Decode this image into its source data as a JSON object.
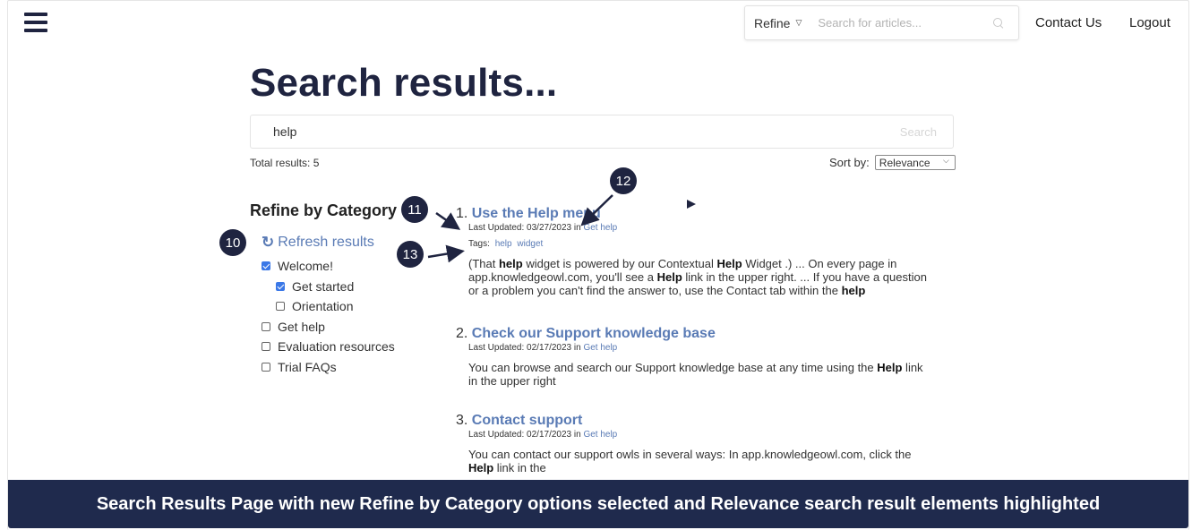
{
  "header": {
    "refine_label": "Refine",
    "search_placeholder": "Search for articles...",
    "contact_label": "Contact Us",
    "logout_label": "Logout"
  },
  "main": {
    "title": "Search results...",
    "search_value": "help",
    "search_button": "Search",
    "total_results": "Total results: 5",
    "sort_label": "Sort by:",
    "sort_value": "Relevance"
  },
  "sidebar": {
    "title": "Refine by Category",
    "refresh_label": "Refresh results",
    "categories": [
      {
        "label": "Welcome!",
        "checked": true
      },
      {
        "label": "Get started",
        "checked": true
      },
      {
        "label": "Orientation",
        "checked": false
      },
      {
        "label": "Get help",
        "checked": false
      },
      {
        "label": "Evaluation resources",
        "checked": false
      },
      {
        "label": "Trial FAQs",
        "checked": false
      }
    ]
  },
  "results": [
    {
      "num": "1.",
      "title": "Use the Help menu",
      "updated": "Last Updated: 03/27/2023 in",
      "category": "Get help",
      "tags_label": "Tags:",
      "tags": [
        "help",
        "widget"
      ],
      "snippet_parts": [
        "(That ",
        "help",
        " widget is powered by our Contextual ",
        "Help",
        " Widget .) ... On every page in app.knowledgeowl.com, you'll see a ",
        "Help",
        " link in the upper right. ... If you have a question or a problem you can't find the answer to, use the Contact tab within the ",
        "help",
        ""
      ]
    },
    {
      "num": "2.",
      "title": "Check our Support knowledge base",
      "updated": "Last Updated: 02/17/2023 in",
      "category": "Get help",
      "snippet_parts": [
        "You can browse and search our Support knowledge base at any time using the ",
        "Help",
        "  link in the upper right"
      ]
    },
    {
      "num": "3.",
      "title": "Contact support",
      "updated": "Last Updated: 02/17/2023 in",
      "category": "Get help",
      "snippet_parts": [
        "You can contact our support owls in several ways: In app.knowledgeowl.com, click the ",
        "Help",
        " link in the"
      ]
    }
  ],
  "callouts": [
    "10",
    "11",
    "12",
    "13"
  ],
  "caption": "Search Results Page with new Refine by Category options selected and Relevance search result elements highlighted",
  "colors": {
    "navy": "#1f2440",
    "link": "#5a7bb5",
    "checkbox": "#3b78e7",
    "caption_bg": "#1f2a4d"
  }
}
